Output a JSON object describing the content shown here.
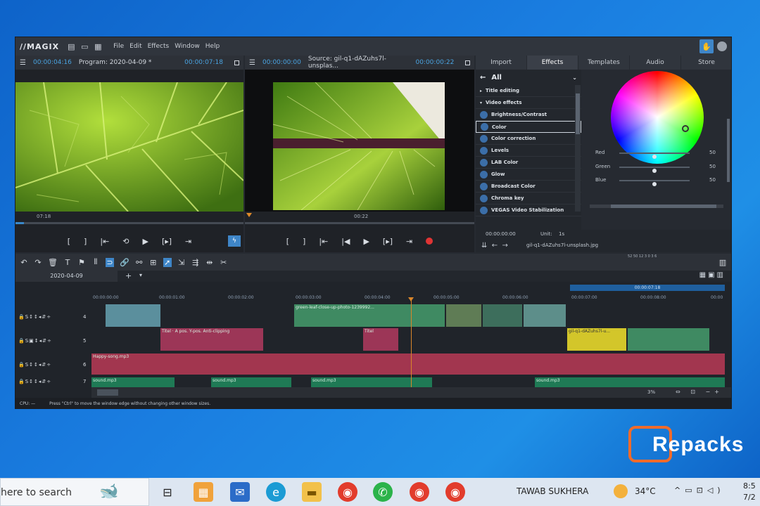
{
  "app": {
    "logo": "//MAGIX",
    "menu": [
      "File",
      "Edit",
      "Effects",
      "Window",
      "Help"
    ]
  },
  "program_monitor": {
    "timecode_left": "00:00:04:16",
    "title": "Program: 2020-04-09 *",
    "timecode_right": "00:00:07:18",
    "position": "07:18",
    "progress": 0.02
  },
  "source_monitor": {
    "timecode_left": "00:00:00:00",
    "title": "Source: gil-q1-dAZuhs7l-unsplas...",
    "timecode_right": "00:00:00:22",
    "position": "00:22",
    "progress": 0.0
  },
  "transport_program": [
    "[",
    "]",
    "|⇤",
    "⟲",
    "▶",
    "[▸]",
    "⇥"
  ],
  "transport_source": [
    "[",
    "]",
    "|⇤",
    "|◀",
    "▶",
    "[▸]",
    "⇥"
  ],
  "tabs": [
    "Import",
    "Effects",
    "Templates",
    "Audio",
    "Store"
  ],
  "active_tab": "Effects",
  "effects": {
    "filter": "All",
    "categories": [
      "Title editing",
      "Video effects"
    ],
    "items": [
      "Brightness/Contrast",
      "Color",
      "Color correction",
      "Levels",
      "LAB Color",
      "Glow",
      "Broadcast Color",
      "Chroma key",
      "VEGAS Video Stabilization"
    ],
    "selected": "Color"
  },
  "color_controls": [
    {
      "label": "Red",
      "value": "50"
    },
    {
      "label": "Green",
      "value": "50"
    },
    {
      "label": "Blue",
      "value": "50"
    }
  ],
  "fx_footer": {
    "timecode": "00:00:00:00",
    "unit_label": "Unit:",
    "unit_value": "1s",
    "file": "gil-q1-dAZuhs7l-unsplash.jpg"
  },
  "timeline": {
    "tab": "2020-04-09",
    "add": "+",
    "ruler": [
      "00:00:00:00",
      "00:00:01:00",
      "00:00:02:00",
      "00:00:03:00",
      "00:00:04:00",
      "00:00:05:00",
      "00:00:06:00",
      "00:00:07:00",
      "00:00:08:00",
      "00:00"
    ],
    "ruler_marker": "00:00:07:18",
    "ruler_numbers": "52 50 12 3 0 3 6",
    "tracks": [
      {
        "num": "4",
        "clips": [
          {
            "label": "",
            "type": "video"
          },
          {
            "label": "green-leaf-close-up-photo-1239992...",
            "type": "video"
          },
          {
            "label": "",
            "type": "video"
          },
          {
            "label": "",
            "type": "video"
          },
          {
            "label": "",
            "type": "video"
          }
        ]
      },
      {
        "num": "5",
        "clips": [
          {
            "label": "Titel · A pos. Y-pos. Anti-clipping",
            "type": "title"
          },
          {
            "label": "Titel",
            "type": "title"
          },
          {
            "label": "gil-q1-dAZuhs7l-u...",
            "type": "video"
          },
          {
            "label": "",
            "type": "video"
          }
        ]
      },
      {
        "num": "6",
        "clips": [
          {
            "label": "Happy-song.mp3",
            "type": "audio"
          }
        ]
      },
      {
        "num": "7",
        "clips": [
          {
            "label": "sound.mp3",
            "type": "sfx"
          },
          {
            "label": "sound.mp3",
            "type": "sfx"
          },
          {
            "label": "sound.mp3",
            "type": "sfx"
          },
          {
            "label": "sound.mp3",
            "type": "sfx"
          }
        ]
      }
    ],
    "zoom": "3%"
  },
  "status": {
    "cpu": "CPU: —",
    "hint": "Press \"Ctrl\" to move the window edge without changing other window sizes."
  },
  "watermark": "Repacks",
  "taskbar": {
    "search": "here to search",
    "user": "TAWAB SUKHERA",
    "temp": "34°C",
    "time": "8:5",
    "date": "7/2"
  }
}
